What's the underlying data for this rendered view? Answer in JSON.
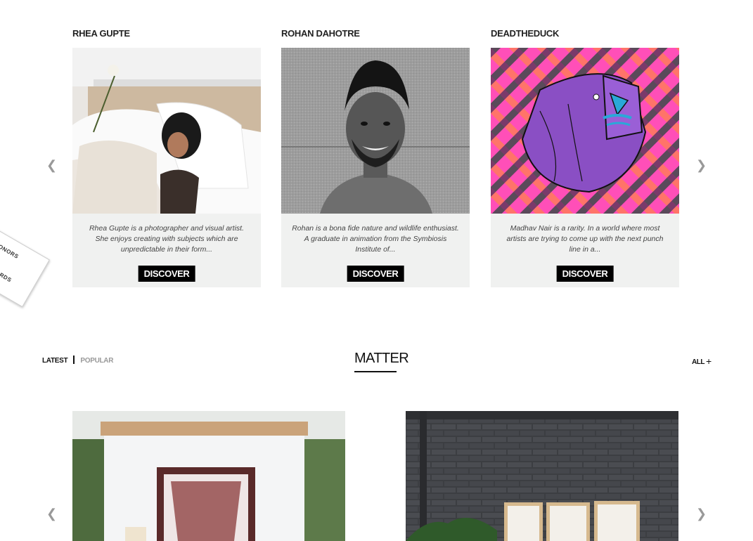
{
  "artists": [
    {
      "name": "RHEA GUPTE",
      "description": "Rhea Gupte is a photographer and visual artist. She enjoys creating with subjects which are unpredictable in their form...",
      "button": "DISCOVER"
    },
    {
      "name": "ROHAN DAHOTRE",
      "description": "Rohan is a bona fide nature and wildlife enthusiast. A graduate in animation from the Symbiosis Institute of...",
      "button": "DISCOVER"
    },
    {
      "name": "DEADTHEDUCK",
      "description": "Madhav Nair is a rarity. In a world where most artists are trying to come up with the next punch line in a...",
      "button": "DISCOVER"
    }
  ],
  "badge": {
    "top": "HONORS",
    "bottom": "AWWWARDS"
  },
  "matter": {
    "filter_latest": "LATEST",
    "filter_popular": "POPULAR",
    "title": "MATTER",
    "all_label": "ALL",
    "all_icon": "plus-icon"
  },
  "icons": {
    "prev": "chevron-left-icon",
    "next": "chevron-right-icon"
  },
  "colors": {
    "card_bg": "#f0f1f0",
    "button_bg": "#000000",
    "muted": "#999999"
  }
}
